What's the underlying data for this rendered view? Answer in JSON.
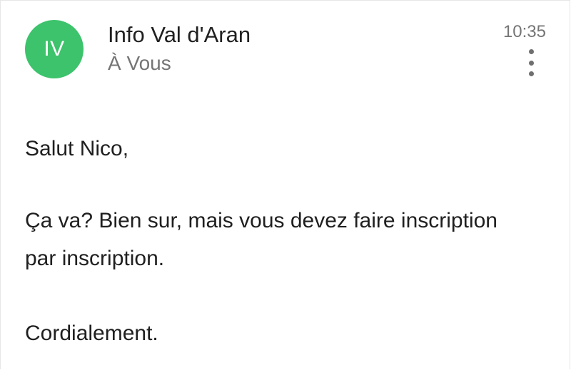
{
  "email": {
    "avatar": {
      "initials": "IV",
      "color": "#3cc36b"
    },
    "sender": "Info Val d'Aran",
    "recipient": "À Vous",
    "time": "10:35",
    "more_icon": "vertical-dots-icon",
    "body": {
      "greeting": "Salut Nico,",
      "paragraph_line1": "Ça va? Bien sur, mais vous devez faire inscription",
      "paragraph_line2": "par inscription.",
      "closing": "Cordialement."
    }
  }
}
